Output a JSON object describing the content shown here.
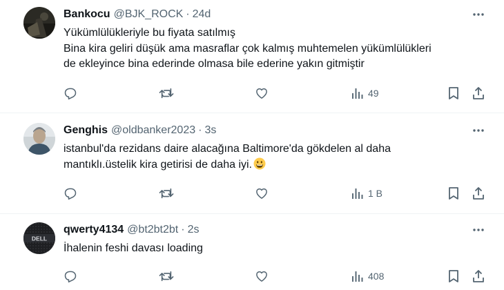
{
  "tweets": [
    {
      "name": "Bankocu",
      "handle": "@BJK_ROCK",
      "separator": "·",
      "time": "24d",
      "lines": [
        "Yükümlülükleriyle bu fiyata satılmış",
        "Bina kira geliri düşük ama masraflar çok kalmış muhtemelen yükümlülükleri",
        "de ekleyince bina ederinde olmasa bile ederine yakın gitmiştir"
      ],
      "views": "49",
      "avatar_icon": "dark-photo-avatar"
    },
    {
      "name": "Genghis",
      "handle": "@oldbanker2023",
      "separator": "·",
      "time": "3s",
      "lines": [
        "istanbul'da rezidans daire alacağına Baltimore'da gökdelen al daha",
        "mantıklı.üstelik kira getirisi de daha iyi."
      ],
      "emoji": "grinning-face-emoji",
      "views": "1 B",
      "avatar_icon": "portrait-avatar"
    },
    {
      "name": "qwerty4134",
      "handle": "@bt2bt2bt",
      "separator": "·",
      "time": "2s",
      "lines": [
        "İhalenin feshi davası loading"
      ],
      "views": "408",
      "avatar_icon": "dell-logo-avatar",
      "avatar_text": "DELL"
    }
  ],
  "icons": {
    "reply": "reply-icon",
    "retweet": "retweet-icon",
    "like": "heart-icon",
    "views": "views-icon",
    "bookmark": "bookmark-icon",
    "share": "share-icon",
    "more": "more-icon"
  },
  "colors": {
    "text": "#0f1419",
    "secondary": "#536471",
    "divider": "#eff3f4"
  }
}
